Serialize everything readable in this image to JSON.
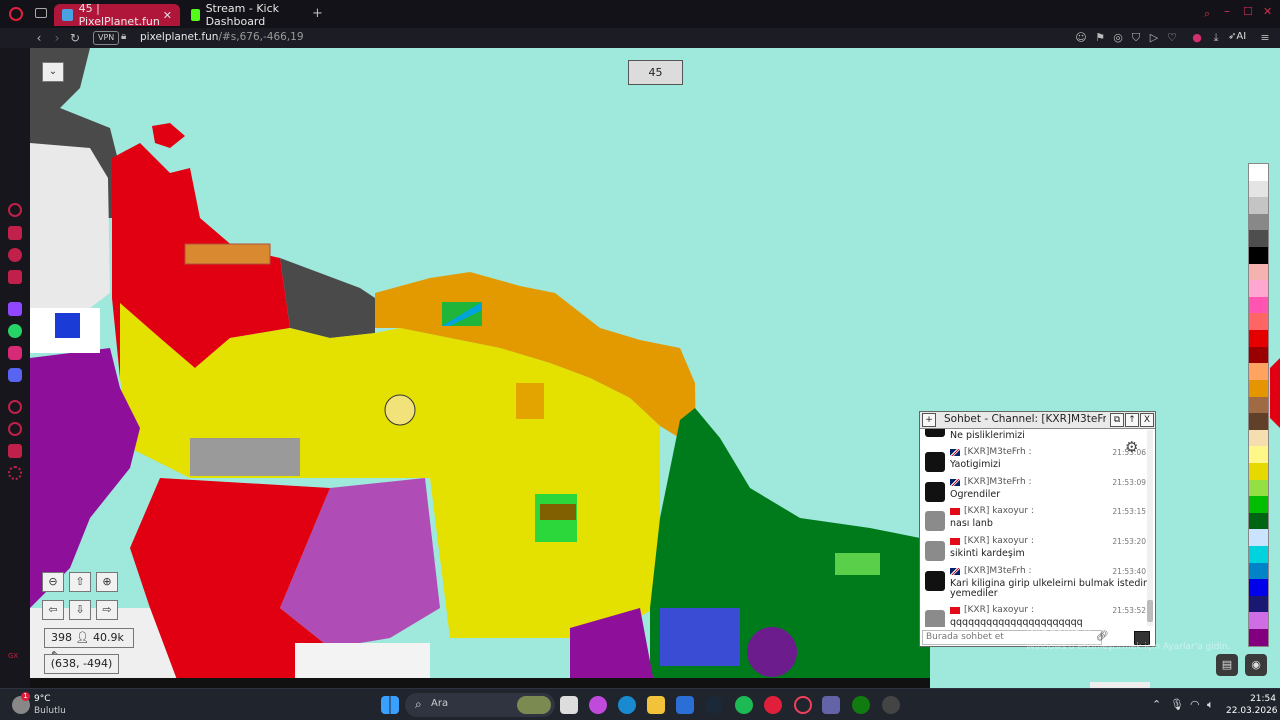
{
  "browser": {
    "tabs": [
      {
        "label": "45 | PixelPlanet.fun",
        "active": true
      },
      {
        "label": "Stream - Kick Dashboard",
        "active": false
      }
    ],
    "new_tab": "+",
    "vpn_label": "VPN",
    "url_host": "pixelplanet.fun",
    "url_rest": "/#s,676,-466,19",
    "ai_label": "AI"
  },
  "canvas": {
    "counter": "45",
    "online": "398",
    "pixels": "40.9k",
    "coords": "(638, -494)",
    "colors": {
      "sea": "#9fe8dc",
      "yellow": "#e4e000",
      "orange": "#e39a00",
      "green": "#007b1b",
      "red": "#e10011",
      "purple": "#8e0f9a",
      "grey": "#4a4a4a"
    },
    "palette": [
      "#ffffff",
      "#e4e4e4",
      "#c4c4c4",
      "#888888",
      "#4e4e4e",
      "#000000",
      "#f4b3ae",
      "#ffa7d1",
      "#ff54b2",
      "#ff6565",
      "#e50000",
      "#9a0000",
      "#fea460",
      "#e59500",
      "#a06a42",
      "#604028",
      "#f5dfb0",
      "#fff889",
      "#e5d900",
      "#94e044",
      "#02be01",
      "#006513",
      "#cae3ff",
      "#00d3dd",
      "#0083c7",
      "#0000ea",
      "#191973",
      "#cf6ee4",
      "#820080"
    ]
  },
  "chat": {
    "title": "Sohbet - Channel: [KXR]M3teFrh",
    "first_line": "Ne pisliklerimizi",
    "messages": [
      {
        "user": "[KXR]M3teFrh :",
        "time": "21:53:06",
        "text": "Yaotigimizi",
        "flag": "uk"
      },
      {
        "user": "[KXR]M3teFrh :",
        "time": "21:53:09",
        "text": "Ogrendiler",
        "flag": "uk"
      },
      {
        "user": "[KXR] kaxoyur :",
        "time": "21:53:15",
        "text": "nası lanb",
        "flag": "tr"
      },
      {
        "user": "[KXR] kaxoyur :",
        "time": "21:53:20",
        "text": "sikinti kardeşim",
        "flag": "tr"
      },
      {
        "user": "[KXR]M3teFrh :",
        "time": "21:53:40",
        "text": "Kari kiligina girip ulkeleirni bulmak istedim",
        "text2": "yemediler",
        "flag": "uk"
      },
      {
        "user": "[KXR] kaxoyur :",
        "time": "21:53:52",
        "text": "qqqqqqqqqqqqqqqqqqqqqq",
        "flag": "tr"
      }
    ],
    "input_placeholder": "Burada sohbet et"
  },
  "windows": {
    "activate_title": "Windows u",
    "activate_sub": "Windows'u etkinleştirmek için Ayarlar'a gidin."
  },
  "taskbar": {
    "temp": "9°C",
    "weather": "Bulutlu",
    "weather_badge": "1",
    "search": "Ara",
    "time": "21:54",
    "date": "22.03.2026"
  }
}
